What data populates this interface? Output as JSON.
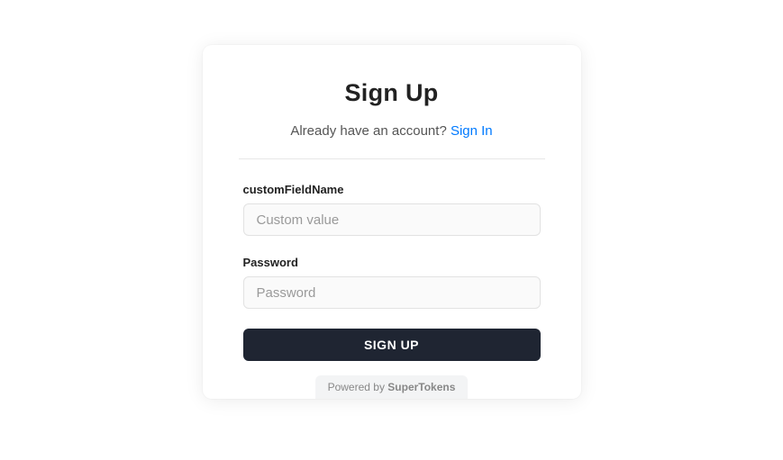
{
  "title": "Sign Up",
  "subtitle": {
    "text": "Already have an account? ",
    "link": "Sign In"
  },
  "fields": [
    {
      "label": "customFieldName",
      "placeholder": "Custom value"
    },
    {
      "label": "Password",
      "placeholder": "Password"
    }
  ],
  "submit_label": "SIGN UP",
  "footer": {
    "prefix": "Powered by ",
    "brand": "SuperTokens"
  }
}
